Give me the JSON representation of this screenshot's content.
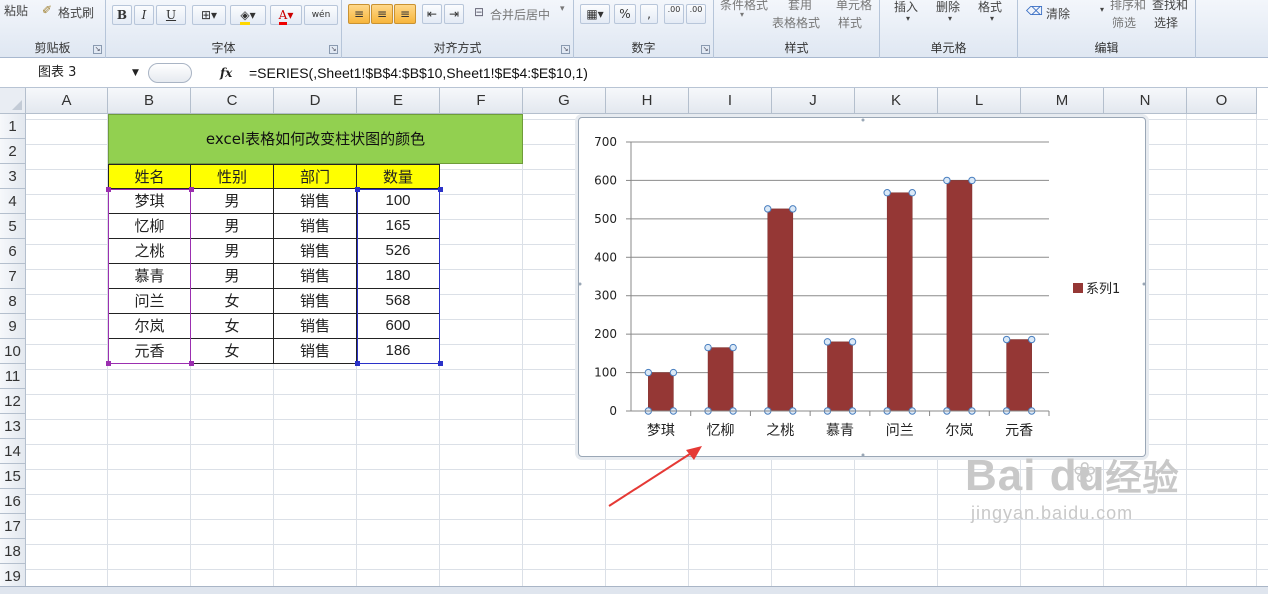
{
  "ribbon": {
    "clipboard": {
      "paste": "粘贴",
      "format_painter": "格式刷",
      "label": "剪贴板"
    },
    "font": {
      "bold": "B",
      "italic": "I",
      "underline": "U",
      "font_color": "A",
      "phonetic": "wén",
      "label": "字体"
    },
    "alignment": {
      "merge_center": "合并后居中",
      "label": "对齐方式"
    },
    "number": {
      "percent": "%",
      "comma": ",",
      "inc_decimal": ".00",
      "dec_decimal": ".00",
      "label": "数字"
    },
    "styles": {
      "conditional": "条件格式",
      "apply": "套用",
      "table_format": "表格格式",
      "cell": "单元格",
      "cell_styles": "样式",
      "label": "样式"
    },
    "cells": {
      "insert": "插入",
      "delete": "删除",
      "format": "格式",
      "label": "单元格"
    },
    "editing": {
      "clear": "清除",
      "sort_filter": "排序和",
      "filter": "筛选",
      "find_select": "查找和",
      "select": "选择",
      "label": "编辑"
    }
  },
  "formula_bar": {
    "name_box": "图表 3",
    "fx": "fx",
    "formula": "=SERIES(,Sheet1!$B$4:$B$10,Sheet1!$E$4:$E$10,1)"
  },
  "columns": [
    "A",
    "B",
    "C",
    "D",
    "E",
    "F",
    "G",
    "H",
    "I",
    "J",
    "K",
    "L",
    "M",
    "N",
    "O"
  ],
  "rows": [
    "1",
    "2",
    "3",
    "4",
    "5",
    "6",
    "7",
    "8",
    "9",
    "10",
    "11",
    "12",
    "13",
    "14",
    "15",
    "16",
    "17",
    "18",
    "19"
  ],
  "sheet": {
    "title": "excel表格如何改变柱状图的颜色",
    "headers": [
      "姓名",
      "性别",
      "部门",
      "数量"
    ],
    "data": [
      [
        "梦琪",
        "男",
        "销售",
        "100"
      ],
      [
        "忆柳",
        "男",
        "销售",
        "165"
      ],
      [
        "之桃",
        "男",
        "销售",
        "526"
      ],
      [
        "慕青",
        "男",
        "销售",
        "180"
      ],
      [
        "问兰",
        "女",
        "销售",
        "568"
      ],
      [
        "尔岚",
        "女",
        "销售",
        "600"
      ],
      [
        "元香",
        "女",
        "销售",
        "186"
      ]
    ]
  },
  "chart_data": {
    "type": "bar",
    "categories": [
      "梦琪",
      "忆柳",
      "之桃",
      "慕青",
      "问兰",
      "尔岚",
      "元香"
    ],
    "series": [
      {
        "name": "系列1",
        "values": [
          100,
          165,
          526,
          180,
          568,
          600,
          186
        ],
        "color": "#953735"
      }
    ],
    "ylim": [
      0,
      700
    ],
    "yticks": [
      0,
      100,
      200,
      300,
      400,
      500,
      600,
      700
    ],
    "grid": true,
    "legend": "right"
  },
  "colors": {
    "title_fill": "#92d050",
    "header_fill": "#ffff00",
    "bar": "#953735",
    "arrow": "#e53935"
  },
  "watermark": {
    "brand": "Bai  du",
    "product": "经验",
    "url": "jingyan.baidu.com"
  }
}
